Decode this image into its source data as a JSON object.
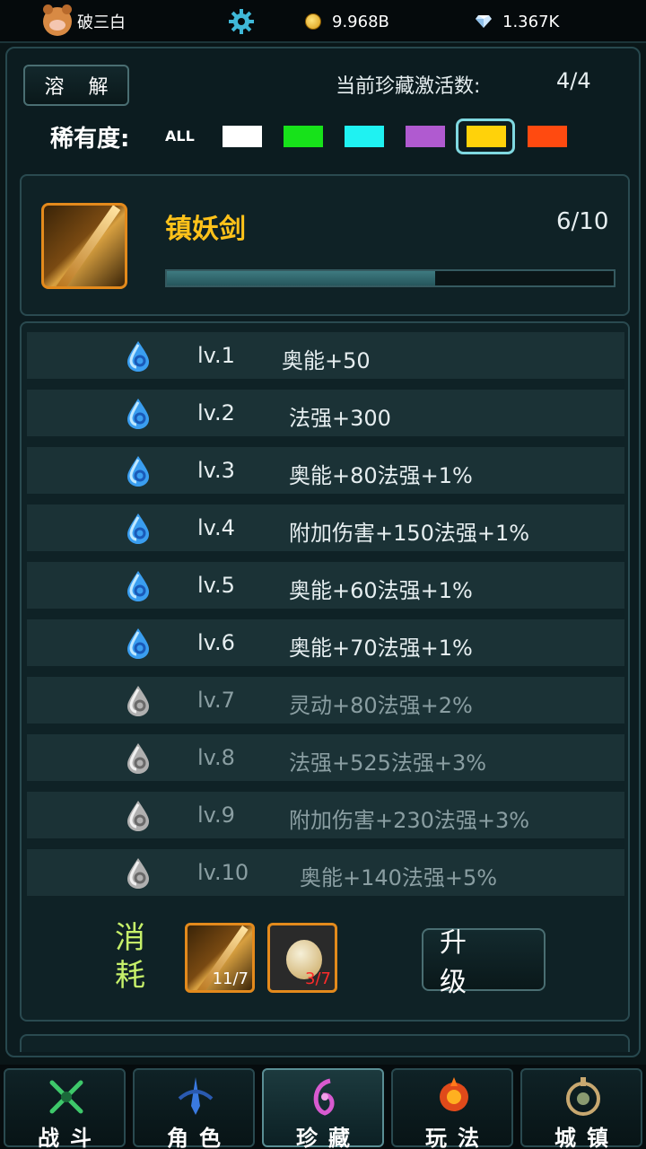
{
  "topbar": {
    "player_name": "破三白",
    "gold": "9.968B",
    "diamonds": "1.367K"
  },
  "header": {
    "dissolve_label": "溶 解",
    "activated_label": "当前珍藏激活数:",
    "activated_value": "4/4",
    "rarity_label": "稀有度:",
    "rarity_all": "ALL",
    "rarity_colors": [
      "#ffffff",
      "#17e21a",
      "#1ff2f2",
      "#b05ad0",
      "#ffd20a",
      "#ff4a10"
    ],
    "selected_rarity_index": 4
  },
  "item": {
    "name": "镇妖剑",
    "progress": "6/10",
    "progress_fraction": 0.6
  },
  "levels": [
    {
      "lv": "lv.1",
      "attr": "奥能+50",
      "unlocked": true
    },
    {
      "lv": "lv.2",
      "attr": "法强+300",
      "unlocked": true
    },
    {
      "lv": "lv.3",
      "attr": "奥能+80法强+1%",
      "unlocked": true
    },
    {
      "lv": "lv.4",
      "attr": "附加伤害+150法强+1%",
      "unlocked": true
    },
    {
      "lv": "lv.5",
      "attr": "奥能+60法强+1%",
      "unlocked": true
    },
    {
      "lv": "lv.6",
      "attr": "奥能+70法强+1%",
      "unlocked": true
    },
    {
      "lv": "lv.7",
      "attr": "灵动+80法强+2%",
      "unlocked": false
    },
    {
      "lv": "lv.8",
      "attr": "法强+525法强+3%",
      "unlocked": false
    },
    {
      "lv": "lv.9",
      "attr": "附加伤害+230法强+3%",
      "unlocked": false
    },
    {
      "lv": "lv.10",
      "attr": "奥能+140法强+5%",
      "unlocked": false
    }
  ],
  "cost": {
    "label": "消耗",
    "items": [
      {
        "count": "11/7",
        "count_color": "#ffffff"
      },
      {
        "count": "3/7",
        "count_color": "#ff2a2a"
      }
    ],
    "upgrade_label": "升 级"
  },
  "nav": {
    "tabs": [
      {
        "label": "战斗",
        "icon": "crossed-swords-icon",
        "active": false
      },
      {
        "label": "角色",
        "icon": "sword-emblem-icon",
        "active": false
      },
      {
        "label": "珍藏",
        "icon": "collection-icon",
        "active": true
      },
      {
        "label": "玩法",
        "icon": "gameplay-icon",
        "active": false
      },
      {
        "label": "城镇",
        "icon": "town-icon",
        "active": false
      }
    ]
  }
}
